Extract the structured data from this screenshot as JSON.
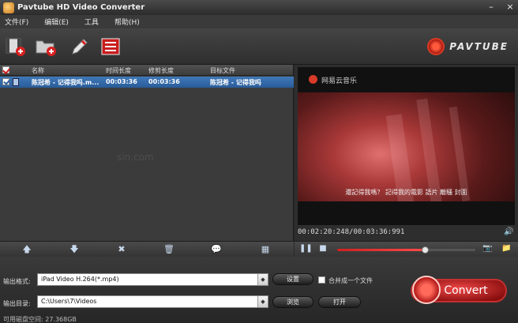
{
  "window": {
    "title": "Pavtube HD Video Converter",
    "controls": [
      "–",
      "×"
    ]
  },
  "menu": [
    "文件(F)",
    "编辑(E)",
    "工具",
    "帮助(H)"
  ],
  "logo": {
    "text": "PAVTUBE"
  },
  "filelist": {
    "columns": [
      "名称",
      "时间长度",
      "修剪长度",
      "目标文件"
    ],
    "rows": [
      {
        "name": "陈冠希 - 记得我吗.m...",
        "duration": "00:03:36",
        "trim": "00:03:36",
        "target": "陈冠希 - 记得我吗"
      }
    ],
    "watermark": "sin.com"
  },
  "preview": {
    "app_overlay": "网易云音乐",
    "subtitle": "還記得我嗎？  記得我的電影  語片  離騷  封面",
    "timecode": "00:02:20:248/00:03:36:991",
    "playback_progress": 0.64
  },
  "output": {
    "format_label": "输出格式:",
    "format_value": "iPad Video H.264(*.mp4)",
    "settings_button": "设置",
    "merge_label": "合并成一个文件",
    "dir_label": "输出目录:",
    "dir_value": "C:\\Users\\7\\Videos",
    "browse_button": "浏览",
    "open_button": "打开",
    "convert_button": "Convert",
    "disk_space": "可用磁盘空间: 27.368GB"
  },
  "colors": {
    "selection": "#2a5c99",
    "accent_red": "#d02020"
  }
}
